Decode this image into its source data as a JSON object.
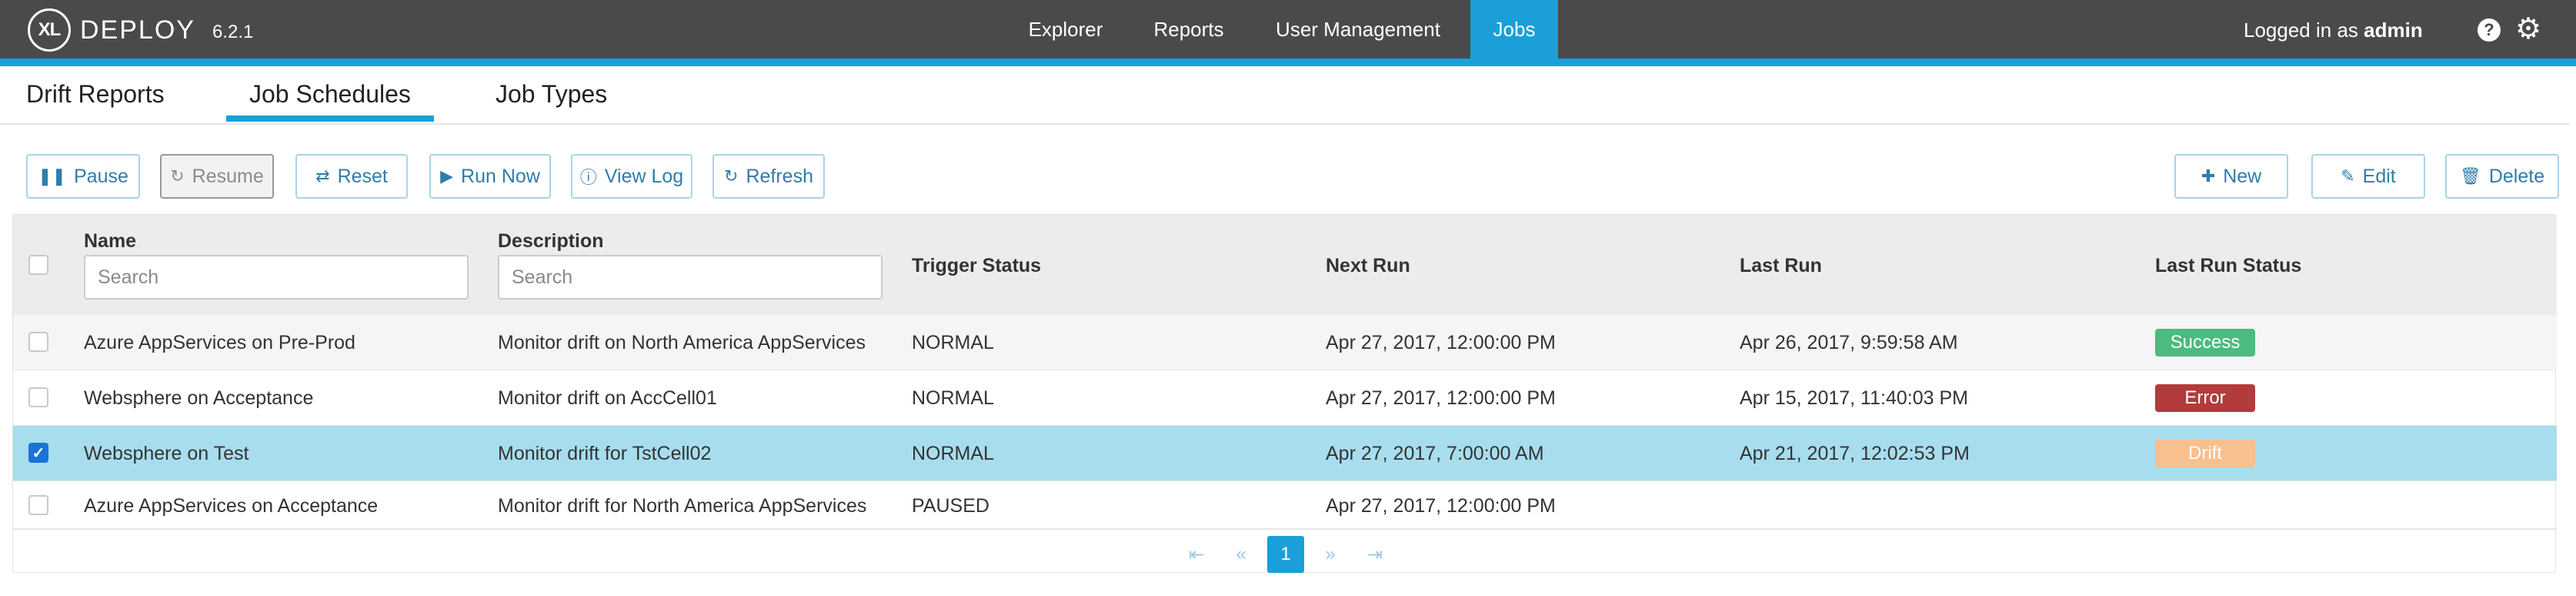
{
  "app": {
    "logo_mark": "XL",
    "name": "DEPLOY",
    "version": "6.2.1"
  },
  "nav": {
    "items": [
      "Explorer",
      "Reports",
      "User Management",
      "Jobs"
    ],
    "active": "Jobs"
  },
  "user": {
    "prefix": "Logged in as",
    "name": "admin"
  },
  "icons": {
    "help": "?",
    "settings": "⚙"
  },
  "tabs": {
    "items": [
      "Drift Reports",
      "Job Schedules",
      "Job Types"
    ],
    "active": "Job Schedules"
  },
  "toolbar": {
    "pause": "Pause",
    "resume": "Resume",
    "reset": "Reset",
    "run_now": "Run Now",
    "view_log": "View Log",
    "refresh": "Refresh",
    "new": "New",
    "edit": "Edit",
    "delete": "Delete"
  },
  "table": {
    "headers": {
      "name": "Name",
      "description": "Description",
      "trigger_status": "Trigger Status",
      "next_run": "Next Run",
      "last_run": "Last Run",
      "last_run_status": "Last Run Status"
    },
    "search_placeholder": "Search",
    "rows": [
      {
        "name": "Azure AppServices on Pre-Prod",
        "description": "Monitor drift on North America AppServices",
        "trigger_status": "NORMAL",
        "next_run": "Apr 27, 2017, 12:00:00 PM",
        "last_run": "Apr 26, 2017, 9:59:58 AM",
        "last_run_status": "Success",
        "checked": false
      },
      {
        "name": "Websphere on Acceptance",
        "description": "Monitor drift on AccCell01",
        "trigger_status": "NORMAL",
        "next_run": "Apr 27, 2017, 12:00:00 PM",
        "last_run": "Apr 15, 2017, 11:40:03 PM",
        "last_run_status": "Error",
        "checked": false
      },
      {
        "name": "Websphere on Test",
        "description": "Monitor drift for TstCell02",
        "trigger_status": "NORMAL",
        "next_run": "Apr 27, 2017, 7:00:00 AM",
        "last_run": "Apr 21, 2017, 12:02:53 PM",
        "last_run_status": "Drift",
        "checked": true
      },
      {
        "name": "Azure AppServices on Acceptance",
        "description": "Monitor drift for North America AppServices",
        "trigger_status": "PAUSED",
        "next_run": "Apr 27, 2017, 12:00:00 PM",
        "last_run": "",
        "last_run_status": "",
        "checked": false
      }
    ]
  },
  "status_colors": {
    "Success": "#4cbb7f",
    "Error": "#b23b3b",
    "Drift": "#f7c08e"
  },
  "pagination": {
    "first": "⇤",
    "prev": "«",
    "current": "1",
    "next": "»",
    "last": "⇥"
  },
  "colors": {
    "topbar": "#4a4a4a",
    "accent": "#1a9fd9",
    "selected_row": "#a8ddee"
  }
}
